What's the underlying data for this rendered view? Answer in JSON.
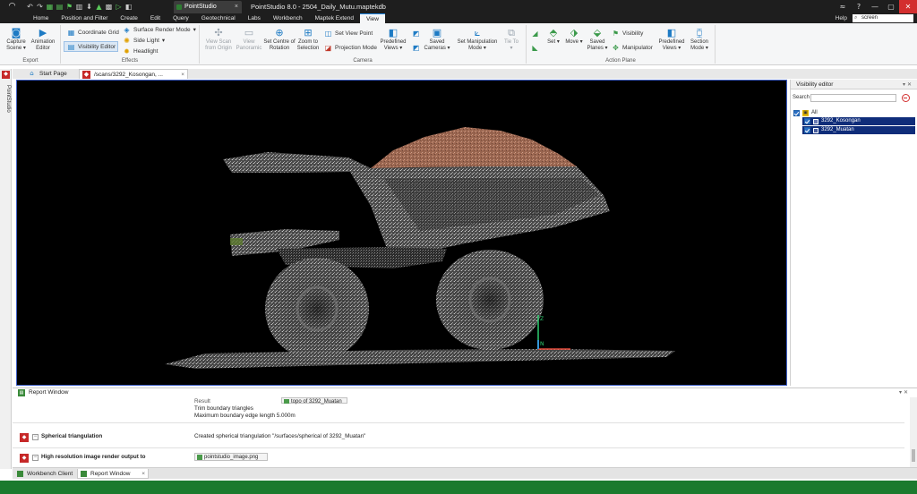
{
  "titlebar": {
    "logo_glyph": "◠",
    "qat_glyphs": [
      "↶",
      "↷",
      "▦",
      "▤",
      "⚑",
      "▥",
      "⬇",
      "▲",
      "▩",
      "▷",
      "◧"
    ],
    "tab_label": "PointStudio",
    "tab_close": "×",
    "title": "PointStudio 8.0 - 2504_Daily_Mutu.maptekdb",
    "window_buttons": [
      "≈",
      "?",
      "—",
      "▢",
      "✕"
    ]
  },
  "menu": {
    "tabs": [
      "Home",
      "Position and Filter",
      "Create",
      "Edit",
      "Query",
      "Geotechnical",
      "Labs",
      "Workbench",
      "Maptek Extend",
      "View"
    ],
    "active_tab": "View",
    "help": "Help",
    "search_value": "screen"
  },
  "ribbon": {
    "capture_scene": "Capture Scene ▾",
    "animation_editor": "Animation Editor",
    "group_export": "Export",
    "coordinate_grid": "Coordinate Grid",
    "visibility_editor": "Visibility Editor",
    "surface_render_mode": "Surface Render Mode",
    "side_light": "Side Light",
    "headlight": "Headlight",
    "group_effects": "Effects",
    "view_scan_from_origin": "View Scan from Origin",
    "view_panoramic": "View Panoramic",
    "set_centre_of_rotation": "Set Centre of Rotation",
    "zoom_to_selection": "Zoom to Selection",
    "set_view_point": "Set View Point",
    "projection_mode": "Projection Mode",
    "predefined_views": "Predefined Views ▾",
    "saved_cameras": "Saved Cameras ▾",
    "set_manipulation_mode": "Set Manipulation Mode ▾",
    "tie_to": "Tie To ▾",
    "group_camera": "Camera",
    "set": "Set ▾",
    "move": "Move ▾",
    "saved_planes": "Saved Planes ▾",
    "visibility": "Visibility",
    "manipulator": "Manipulator",
    "predefined_views_2": "Predefined Views ▾",
    "section_mode": "Section Mode ▾",
    "group_action_plane": "Action Plane"
  },
  "doc_tabs": {
    "start_page": "Start Page",
    "scan_tab": "/scans/3292_Kosongan, ...",
    "scan_close": "×"
  },
  "left_strip": {
    "label": "PointStudio"
  },
  "visibility_editor": {
    "title": "Visibility editor",
    "header_controls": "▾ ✕",
    "search_label": "Search",
    "tree": [
      {
        "label": "All",
        "level": 0,
        "selected": false
      },
      {
        "label": "3292_Kosongan",
        "level": 1,
        "selected": true,
        "color": "#6b7cb5"
      },
      {
        "label": "3292_Muatan",
        "level": 1,
        "selected": true,
        "color": "#4a5f9e"
      }
    ]
  },
  "report": {
    "title": "Report Window",
    "header_controls": "▾ ✕",
    "result_label": "Result",
    "result_chip": "topo of 3292_Muatan",
    "trim_line": "Trim boundary triangles",
    "max_edge_line": "Maximum boundary edge length  5.000m",
    "entries": [
      {
        "name": "Spherical triangulation",
        "message": "Created spherical triangulation \"/surfaces/spherical of 3292_Muatan\""
      },
      {
        "name": "High resolution image render output to",
        "chip": "pointstudio_image.png"
      }
    ]
  },
  "bottom_tabs": {
    "workbench_client": "Workbench Client",
    "report_window": "Report Window",
    "close": "×"
  },
  "colors": {
    "accent": "#1e88e5",
    "status_bar": "#1b7a2e",
    "selection": "#0f2d7a",
    "viewport_border": "#3e5fc7"
  }
}
